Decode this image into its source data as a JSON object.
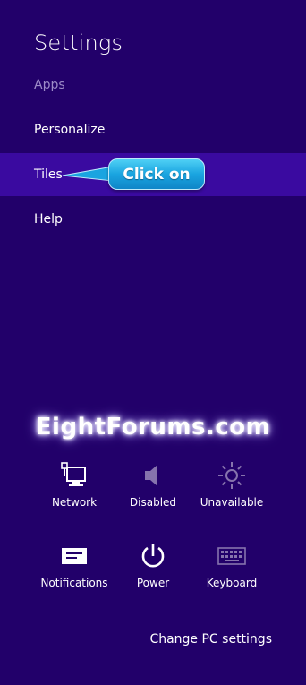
{
  "panel": {
    "title": "Settings"
  },
  "menu": {
    "section_label": "Apps",
    "items": [
      {
        "label": "Personalize"
      },
      {
        "label": "Tiles"
      },
      {
        "label": "Help"
      }
    ]
  },
  "callout": {
    "text": "Click on",
    "color": "#1aa4e0"
  },
  "watermark": {
    "text": "EightForums.com"
  },
  "quick_settings": [
    {
      "label": "Network",
      "icon": "network-icon"
    },
    {
      "label": "Disabled",
      "icon": "volume-icon"
    },
    {
      "label": "Unavailable",
      "icon": "brightness-icon"
    },
    {
      "label": "Notifications",
      "icon": "notifications-icon"
    },
    {
      "label": "Power",
      "icon": "power-icon"
    },
    {
      "label": "Keyboard",
      "icon": "keyboard-icon"
    }
  ],
  "footer": {
    "change_pc_settings": "Change PC settings"
  },
  "colors": {
    "background": "#22006a",
    "selected": "#3a0aa0",
    "section_text": "#9d8bc8"
  }
}
